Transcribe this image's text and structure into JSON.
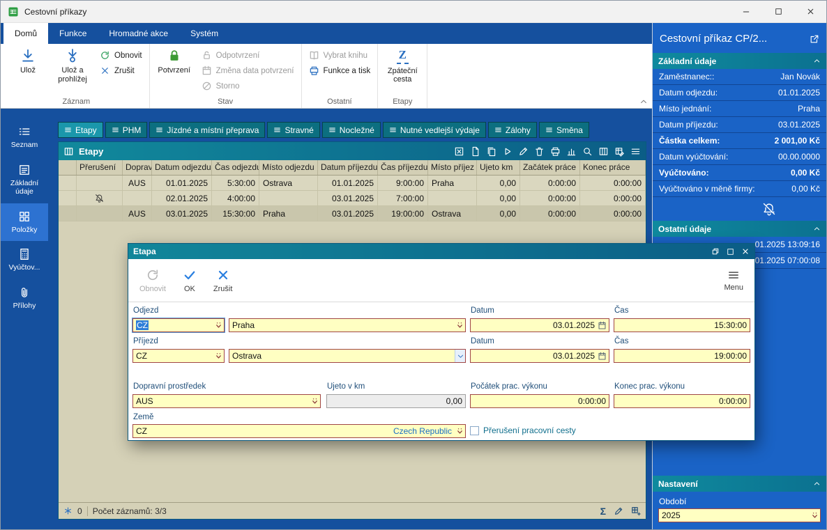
{
  "window": {
    "title": "Cestovní příkazy"
  },
  "ribbon": {
    "tabs": [
      {
        "label": "Domů",
        "active": true
      },
      {
        "label": "Funkce",
        "active": false
      },
      {
        "label": "Hromadné akce",
        "active": false
      },
      {
        "label": "Systém",
        "active": false
      }
    ],
    "groups": [
      {
        "label": "Záznam",
        "buttons": [
          {
            "label": "Ulož",
            "icon": "save",
            "size": "large",
            "disabled": false
          },
          {
            "label": "Ulož a prohlížej",
            "icon": "save-view",
            "size": "large",
            "disabled": false
          },
          {
            "label": "Obnovit",
            "icon": "refresh",
            "size": "small",
            "disabled": false
          },
          {
            "label": "Zrušit",
            "icon": "cross",
            "size": "small",
            "disabled": false
          }
        ]
      },
      {
        "label": "Stav",
        "buttons": [
          {
            "label": "Potvrzení",
            "icon": "lock",
            "size": "large",
            "disabled": false,
            "icon_color": "#3d9a35"
          },
          {
            "label": "Odpotvrzení",
            "icon": "lock-open",
            "size": "small",
            "disabled": true
          },
          {
            "label": "Změna data potvrzení",
            "icon": "calendar",
            "size": "small",
            "disabled": true
          },
          {
            "label": "Storno",
            "icon": "storno",
            "size": "small",
            "disabled": true
          }
        ]
      },
      {
        "label": "Ostatní",
        "buttons": [
          {
            "label": "Vybrat knihu",
            "icon": "book",
            "size": "small",
            "disabled": true
          },
          {
            "label": "Funkce a tisk",
            "icon": "printer",
            "size": "small",
            "disabled": false
          }
        ]
      },
      {
        "label": "Etapy",
        "buttons": [
          {
            "label": "Zpáteční cesta",
            "icon": "z-return",
            "size": "large",
            "disabled": false
          }
        ]
      }
    ]
  },
  "sidebar": {
    "items": [
      {
        "label": "Seznam",
        "icon": "list",
        "active": false
      },
      {
        "label": "Základní údaje",
        "icon": "form",
        "active": false
      },
      {
        "label": "Položky",
        "icon": "items",
        "active": true
      },
      {
        "label": "Vyúčtov...",
        "icon": "calc",
        "active": false
      },
      {
        "label": "Přílohy",
        "icon": "clip",
        "active": false
      }
    ]
  },
  "module_tabs": [
    {
      "label": "Etapy",
      "active": true
    },
    {
      "label": "PHM",
      "active": false
    },
    {
      "label": "Jízdné a místní přeprava",
      "active": false
    },
    {
      "label": "Stravné",
      "active": false
    },
    {
      "label": "Nocležné",
      "active": false
    },
    {
      "label": "Nutné vedlejší výdaje",
      "active": false
    },
    {
      "label": "Zálohy",
      "active": false
    },
    {
      "label": "Směna",
      "active": false
    }
  ],
  "grid": {
    "title": "Etapy",
    "toolbar_icons": [
      "excel",
      "doc-new",
      "doc-copy",
      "play",
      "pencil",
      "trash",
      "printer",
      "chart",
      "preview",
      "columns",
      "table-edit",
      "menu"
    ],
    "columns": [
      "Přerušení",
      "Doprav",
      "Datum odjezdu",
      "Čas odjezdu",
      "Místo odjezdu",
      "Datum příjezdu",
      "Čas příjezdu",
      "Místo příjez",
      "Ujeto km",
      "Začátek práce",
      "Konec práce"
    ],
    "rows": [
      {
        "interruption": false,
        "selected": false,
        "values": [
          "AUS",
          "01.01.2025",
          "5:30:00",
          "Ostrava",
          "01.01.2025",
          "9:00:00",
          "Praha",
          "0,00",
          "0:00:00",
          "0:00:00"
        ]
      },
      {
        "interruption": true,
        "selected": false,
        "values": [
          "",
          "02.01.2025",
          "4:00:00",
          "",
          "03.01.2025",
          "7:00:00",
          "",
          "0,00",
          "0:00:00",
          "0:00:00"
        ]
      },
      {
        "interruption": false,
        "selected": true,
        "values": [
          "AUS",
          "03.01.2025",
          "15:30:00",
          "Praha",
          "03.01.2025",
          "19:00:00",
          "Ostrava",
          "0,00",
          "0:00:00",
          "0:00:00"
        ]
      }
    ],
    "footer": {
      "left_value": "0",
      "count_label": "Počet záznamů: 3/3"
    }
  },
  "dialog": {
    "title": "Etapa",
    "toolbar": {
      "refresh": "Obnovit",
      "ok": "OK",
      "cancel": "Zrušit",
      "menu": "Menu"
    },
    "form": {
      "odjezd_label": "Odjezd",
      "odjezd_country": "CZ",
      "odjezd_place": "Praha",
      "datum1_label": "Datum",
      "datum1": "03.01.2025",
      "cas1_label": "Čas",
      "cas1": "15:30:00",
      "prijezd_label": "Příjezd",
      "prijezd_country": "CZ",
      "prijezd_place": "Ostrava",
      "datum2_label": "Datum",
      "datum2": "03.01.2025",
      "cas2_label": "Čas",
      "cas2": "19:00:00",
      "dopravni_label": "Dopravní prostředek",
      "dopravni": "AUS",
      "ujeto_label": "Ujeto v km",
      "ujeto": "0,00",
      "pocatek_label": "Počátek prac. výkonu",
      "pocatek": "0:00:00",
      "konec_label": "Konec prac. výkonu",
      "konec": "0:00:00",
      "zeme_label": "Země",
      "zeme_code": "CZ",
      "zeme_name": "Czech Republic",
      "preruseni_checkbox_label": "Přerušení pracovní cesty",
      "preruseni_checked": false
    }
  },
  "right_panel": {
    "title": "Cestovní příkaz CP/2...",
    "sections": [
      {
        "header": "Základní údaje",
        "rows": [
          {
            "label": "Zaměstnanec::",
            "value": "Jan Novák",
            "bold": false
          },
          {
            "label": "Datum odjezdu:",
            "value": "01.01.2025",
            "bold": false
          },
          {
            "label": "Místo jednání:",
            "value": "Praha",
            "bold": false
          },
          {
            "label": "Datum příjezdu:",
            "value": "03.01.2025",
            "bold": false
          },
          {
            "label": "Částka celkem:",
            "value": "2 001,00 Kč",
            "bold": true
          },
          {
            "label": "Datum vyúčtování:",
            "value": "00.00.0000",
            "bold": false
          },
          {
            "label": "Vyúčtováno:",
            "value": "0,00 Kč",
            "bold": true
          },
          {
            "label": "Vyúčtováno v měně firmy:",
            "value": "0,00 Kč",
            "bold": false
          }
        ]
      },
      {
        "header": "Ostatní údaje",
        "rows": [
          {
            "label": "",
            "value": "01.2025 13:09:16",
            "bold": false
          },
          {
            "label": "",
            "value": "01.2025 07:00:08",
            "bold": false
          }
        ]
      }
    ],
    "settings": {
      "header": "Nastavení",
      "field_label": "Období",
      "value": "2025"
    }
  }
}
